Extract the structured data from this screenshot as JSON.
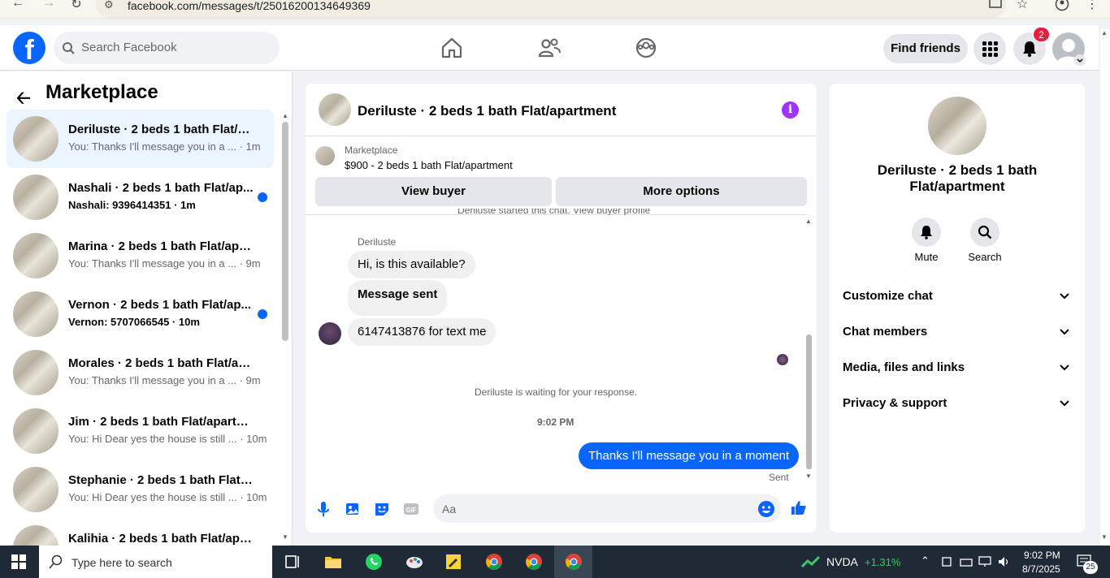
{
  "browser": {
    "url": "facebook.com/messages/t/25016200134649369"
  },
  "header": {
    "search_placeholder": "Search Facebook",
    "find_friends": "Find friends",
    "notif_count": "2",
    "logo": "f"
  },
  "left": {
    "title": "Marketplace",
    "conversations": [
      {
        "name": "Deriluste · 2 beds 1 bath Flat/ap...",
        "preview": "You: Thanks I'll message you in a ... · 1m",
        "unread": false,
        "active": true
      },
      {
        "name": "Nashali · 2 beds 1 bath Flat/ap...",
        "preview": "Nashali: 9396414351 · 1m",
        "unread": true,
        "active": false
      },
      {
        "name": "Marina · 2 beds 1 bath Flat/apart...",
        "preview": "You: Thanks I'll message you in a ... · 9m",
        "unread": false,
        "active": false
      },
      {
        "name": "Vernon · 2 beds 1 bath Flat/ap...",
        "preview": "Vernon: 5707066545 · 10m",
        "unread": true,
        "active": false
      },
      {
        "name": "Morales · 2 beds 1 bath Flat/apa...",
        "preview": "You: Thanks I'll message you in a ... · 9m",
        "unread": false,
        "active": false
      },
      {
        "name": "Jim · 2 beds 1 bath Flat/apartment",
        "preview": "You: Hi Dear yes the house is still ... · 10m",
        "unread": false,
        "active": false
      },
      {
        "name": "Stephanie · 2 beds 1 bath Flat/a...",
        "preview": "You: Hi Dear yes the house is still ... · 10m",
        "unread": false,
        "active": false
      },
      {
        "name": "Kalihia · 2 beds 1 bath Flat/apart...",
        "preview": "",
        "unread": false,
        "active": false
      }
    ]
  },
  "chat": {
    "title": "Deriluste · 2 beds 1 bath Flat/apartment",
    "marketplace_label": "Marketplace",
    "listing": "$900 - 2 beds 1 bath Flat/apartment",
    "view_buyer": "View buyer",
    "more_options": "More options",
    "started_line": "Deriluste started this chat. View buyer profile",
    "sender": "Deriluste",
    "messages": [
      "Hi, is this available?",
      "Message sent",
      "6147413876 for text me"
    ],
    "waiting": "Deriluste is waiting for your response.",
    "time": "9:02 PM",
    "outgoing": "Thanks I'll message you in a moment",
    "sent": "Sent",
    "composer_placeholder": "Aa",
    "info_glyph": "i"
  },
  "right": {
    "title": "Deriluste · 2 beds 1 bath Flat/apartment",
    "actions": [
      "Mute",
      "Search"
    ],
    "sections": [
      "Customize chat",
      "Chat members",
      "Media, files and links",
      "Privacy & support"
    ]
  },
  "taskbar": {
    "search_placeholder": "Type here to search",
    "stock": "NVDA",
    "stock_change": "+1.31%",
    "time": "9:02 PM",
    "date": "8/7/2025",
    "notif_count": "25"
  },
  "colors": {
    "fb_blue": "#0866ff",
    "unread_dot": "#0866ff",
    "info_purple": "#a033ff",
    "badge_red": "#e41e3f",
    "stock_green": "#3fc862"
  }
}
